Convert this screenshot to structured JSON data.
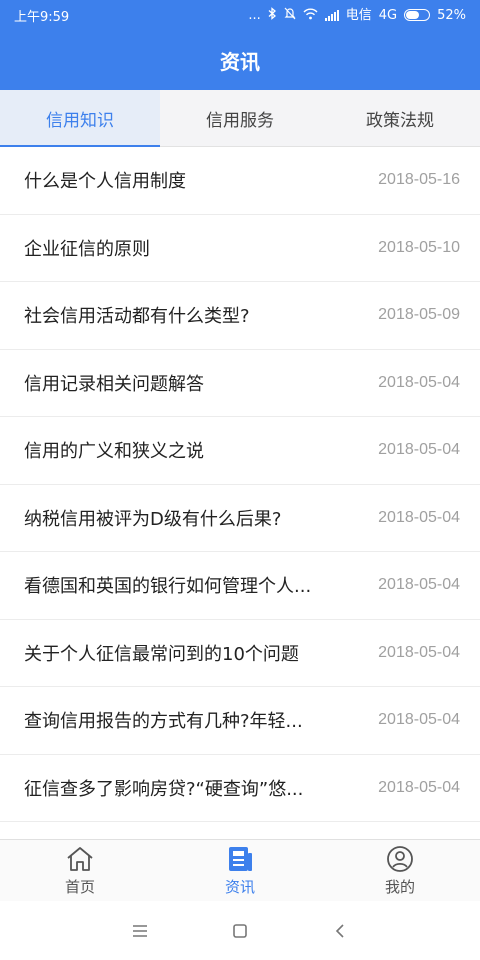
{
  "status_bar": {
    "time": "上午9:59",
    "dots": "...",
    "carrier": "电信",
    "network": "4G",
    "battery": "52%",
    "battery_level": 0.52
  },
  "header": {
    "title": "资讯"
  },
  "tabs": [
    {
      "label": "信用知识",
      "active": true
    },
    {
      "label": "信用服务",
      "active": false
    },
    {
      "label": "政策法规",
      "active": false
    }
  ],
  "articles": [
    {
      "title": "什么是个人信用制度",
      "date": "2018-05-16"
    },
    {
      "title": "企业征信的原则",
      "date": "2018-05-10"
    },
    {
      "title": "社会信用活动都有什么类型?",
      "date": "2018-05-09"
    },
    {
      "title": "信用记录相关问题解答",
      "date": "2018-05-04"
    },
    {
      "title": "信用的广义和狭义之说",
      "date": "2018-05-04"
    },
    {
      "title": "纳税信用被评为D级有什么后果?",
      "date": "2018-05-04"
    },
    {
      "title": "看德国和英国的银行如何管理个人...",
      "date": "2018-05-04"
    },
    {
      "title": "关于个人征信最常问到的10个问题",
      "date": "2018-05-04"
    },
    {
      "title": "查询信用报告的方式有几种?年轻...",
      "date": "2018-05-04"
    },
    {
      "title": "征信查多了影响房贷?“硬查询”悠...",
      "date": "2018-05-04"
    }
  ],
  "bottom_nav": [
    {
      "label": "首页",
      "icon": "home-icon",
      "active": false
    },
    {
      "label": "资讯",
      "icon": "news-icon",
      "active": true
    },
    {
      "label": "我的",
      "icon": "user-icon",
      "active": false
    }
  ],
  "colors": {
    "primary": "#3d80ec",
    "tab_bg": "#f4f4f6",
    "date": "#a0a0a0"
  }
}
